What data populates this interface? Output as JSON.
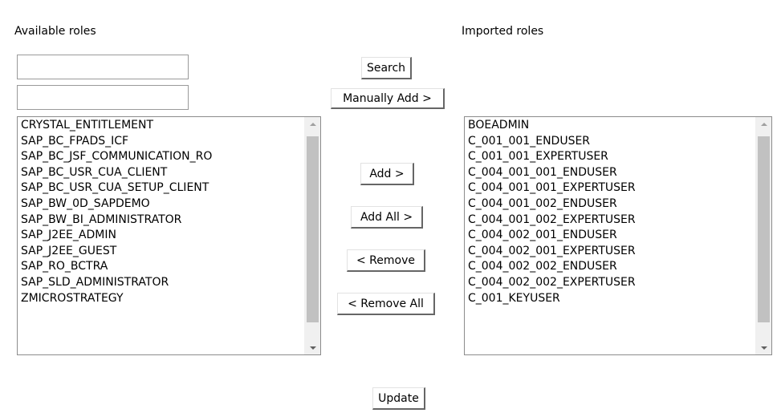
{
  "headings": {
    "available": "Available roles",
    "imported": "Imported roles"
  },
  "search": {
    "value_1": "",
    "value_2": "",
    "search_label": "Search",
    "manual_add_label": "Manually Add >"
  },
  "available_roles": [
    "CRYSTAL_ENTITLEMENT",
    "SAP_BC_FPADS_ICF",
    "SAP_BC_JSF_COMMUNICATION_RO",
    "SAP_BC_USR_CUA_CLIENT",
    "SAP_BC_USR_CUA_SETUP_CLIENT",
    "SAP_BW_0D_SAPDEMO",
    "SAP_BW_BI_ADMINISTRATOR",
    "SAP_J2EE_ADMIN",
    "SAP_J2EE_GUEST",
    "SAP_RO_BCTRA",
    "SAP_SLD_ADMINISTRATOR",
    "ZMICROSTRATEGY"
  ],
  "imported_roles": [
    "BOEADMIN",
    "C_001_001_ENDUSER",
    "C_001_001_EXPERTUSER",
    "C_004_001_001_ENDUSER",
    "C_004_001_001_EXPERTUSER",
    "C_004_001_002_ENDUSER",
    "C_004_001_002_EXPERTUSER",
    "C_004_002_001_ENDUSER",
    "C_004_002_001_EXPERTUSER",
    "C_004_002_002_ENDUSER",
    "C_004_002_002_EXPERTUSER",
    "C_001_KEYUSER"
  ],
  "actions": {
    "add": "Add >",
    "add_all": "Add All >",
    "remove": "< Remove",
    "remove_all": "< Remove All",
    "update": "Update"
  },
  "icons": {
    "scroll_up": "chevron-up-icon",
    "scroll_down": "chevron-down-icon"
  }
}
